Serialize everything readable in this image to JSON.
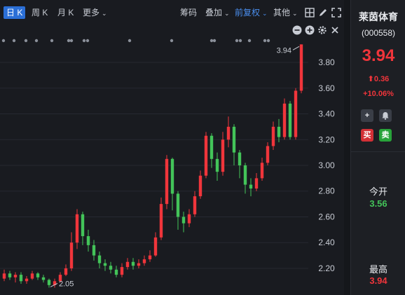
{
  "toolbar": {
    "period_day": "日 K",
    "period_week": "周 K",
    "period_month": "月 K",
    "more": "更多",
    "chips": "筹码",
    "overlay": "叠加",
    "adjust": "前复权",
    "other": "其他"
  },
  "stock": {
    "name": "莱茵体育",
    "code": "(000558)",
    "price": "3.94",
    "change": "0.36",
    "change_pct": "+10.06%"
  },
  "actions": {
    "buy": "买",
    "sell": "卖"
  },
  "stats": {
    "open_label": "今开",
    "open_value": "3.56",
    "high_label": "最高",
    "high_value": "3.94"
  },
  "colors": {
    "up": "#f0353b",
    "down": "#43c459",
    "accent": "#2b6fd6",
    "background": "#191b20"
  },
  "icons": [
    "chevron-down-icon",
    "grid-icon",
    "pencil-icon",
    "fullscreen-icon",
    "minus-icon",
    "plus-icon",
    "settings-icon",
    "close-icon",
    "bell-icon",
    "arrow-up-icon"
  ],
  "chart_data": {
    "type": "candlestick",
    "y_ticks": [
      "3.80",
      "3.60",
      "3.40",
      "3.20",
      "3.00",
      "2.80",
      "2.60",
      "2.40",
      "2.20"
    ],
    "ylim": [
      2.02,
      3.98
    ],
    "annotations": {
      "high_label": "3.94",
      "low_label": "2.05"
    },
    "candles": [
      [
        2.12,
        2.16,
        2.19,
        2.1
      ],
      [
        2.16,
        2.13,
        2.18,
        2.11
      ],
      [
        2.13,
        2.15,
        2.17,
        2.09
      ],
      [
        2.15,
        2.1,
        2.17,
        2.08
      ],
      [
        2.1,
        2.12,
        2.14,
        2.08
      ],
      [
        2.12,
        2.16,
        2.18,
        2.11
      ],
      [
        2.16,
        2.13,
        2.17,
        2.11
      ],
      [
        2.13,
        2.11,
        2.15,
        2.09
      ],
      [
        2.11,
        2.07,
        2.12,
        2.05
      ],
      [
        2.07,
        2.1,
        2.12,
        2.05
      ],
      [
        2.1,
        2.15,
        2.17,
        2.09
      ],
      [
        2.15,
        2.2,
        2.23,
        2.14
      ],
      [
        2.2,
        2.4,
        2.48,
        2.18
      ],
      [
        2.4,
        2.62,
        2.66,
        2.35
      ],
      [
        2.62,
        2.45,
        2.64,
        2.38
      ],
      [
        2.45,
        2.38,
        2.5,
        2.33
      ],
      [
        2.38,
        2.3,
        2.42,
        2.26
      ],
      [
        2.3,
        2.24,
        2.33,
        2.2
      ],
      [
        2.24,
        2.22,
        2.27,
        2.18
      ],
      [
        2.22,
        2.19,
        2.25,
        2.16
      ],
      [
        2.19,
        2.15,
        2.22,
        2.13
      ],
      [
        2.15,
        2.21,
        2.24,
        2.13
      ],
      [
        2.21,
        2.25,
        2.28,
        2.19
      ],
      [
        2.25,
        2.22,
        2.28,
        2.19
      ],
      [
        2.22,
        2.24,
        2.27,
        2.2
      ],
      [
        2.24,
        2.27,
        2.3,
        2.22
      ],
      [
        2.27,
        2.3,
        2.34,
        2.25
      ],
      [
        2.3,
        2.44,
        2.48,
        2.29
      ],
      [
        2.44,
        2.7,
        2.75,
        2.42
      ],
      [
        2.7,
        3.05,
        3.08,
        2.66
      ],
      [
        3.05,
        2.78,
        3.06,
        2.65
      ],
      [
        2.78,
        2.6,
        2.8,
        2.5
      ],
      [
        2.6,
        2.55,
        2.64,
        2.48
      ],
      [
        2.55,
        2.62,
        2.66,
        2.52
      ],
      [
        2.62,
        2.76,
        2.8,
        2.6
      ],
      [
        2.76,
        2.92,
        2.96,
        2.74
      ],
      [
        2.92,
        3.23,
        3.26,
        2.9
      ],
      [
        3.23,
        3.05,
        3.25,
        2.98
      ],
      [
        3.05,
        2.95,
        3.1,
        2.88
      ],
      [
        2.95,
        3.2,
        3.26,
        2.92
      ],
      [
        3.2,
        3.3,
        3.38,
        3.14
      ],
      [
        3.3,
        3.1,
        3.32,
        3.0
      ],
      [
        3.1,
        3.0,
        3.12,
        2.9
      ],
      [
        3.0,
        2.85,
        3.02,
        2.78
      ],
      [
        2.85,
        2.82,
        2.9,
        2.76
      ],
      [
        2.82,
        2.9,
        2.94,
        2.8
      ],
      [
        2.9,
        3.02,
        3.06,
        2.88
      ],
      [
        3.02,
        3.15,
        3.18,
        3.0
      ],
      [
        3.15,
        3.3,
        3.34,
        3.12
      ],
      [
        3.3,
        3.22,
        3.36,
        3.18
      ],
      [
        3.22,
        3.48,
        3.52,
        3.2
      ],
      [
        3.48,
        3.22,
        3.5,
        3.2
      ],
      [
        3.22,
        3.58,
        3.6,
        3.2
      ],
      [
        3.58,
        3.94,
        3.94,
        3.56
      ]
    ]
  }
}
